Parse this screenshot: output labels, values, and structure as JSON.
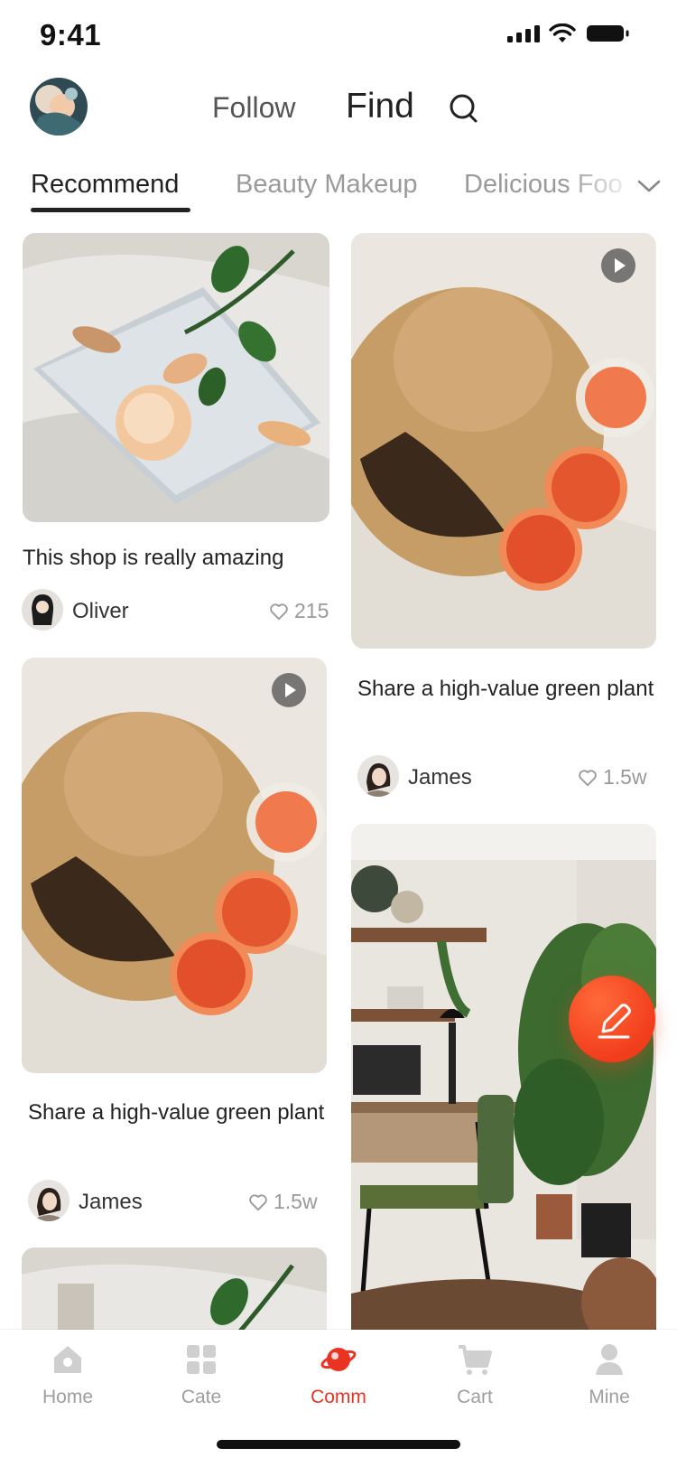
{
  "status": {
    "time": "9:41"
  },
  "header": {
    "follow": "Follow",
    "find": "Find"
  },
  "tabs": [
    "Recommend",
    "Beauty Makeup",
    "Delicious Foo"
  ],
  "cards": [
    {
      "title": "This shop is really amazing",
      "author": "Oliver",
      "likes": "215"
    },
    {
      "title": "Share a high-value green plant",
      "author": "James",
      "likes": "1.5w"
    },
    {
      "title": "Share a high-value green plant",
      "author": "James",
      "likes": "1.5w"
    }
  ],
  "tabbar": {
    "items": [
      {
        "label": "Home",
        "icon": "home-icon"
      },
      {
        "label": "Cate",
        "icon": "category-grid-icon"
      },
      {
        "label": "Comm",
        "icon": "planet-icon"
      },
      {
        "label": "Cart",
        "icon": "cart-icon"
      },
      {
        "label": "Mine",
        "icon": "user-icon"
      }
    ],
    "active_index": 2
  },
  "colors": {
    "accent": "#e93323",
    "fab": "#f23d1c",
    "text": "#222222",
    "muted": "#999999"
  }
}
